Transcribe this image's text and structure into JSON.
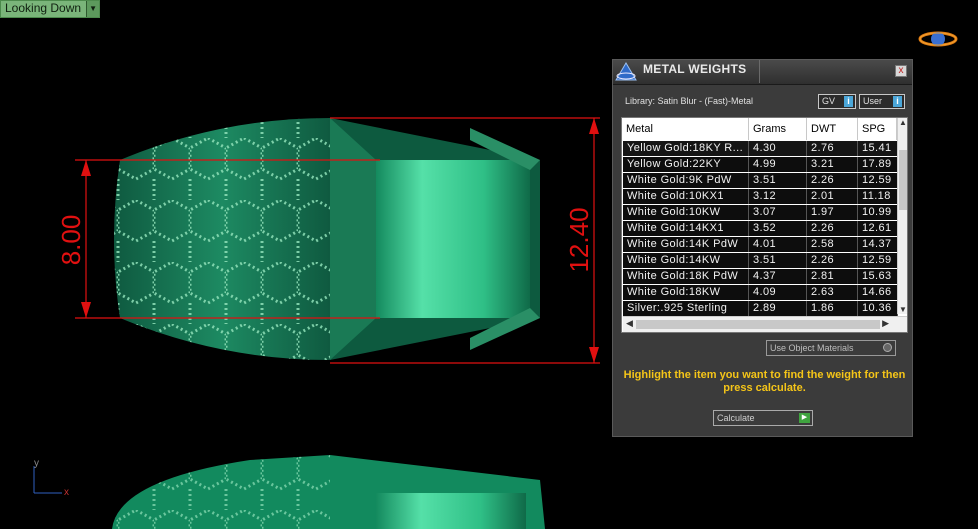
{
  "view": {
    "dropdown_label": "Looking Down",
    "dropdown_arrow": "▼"
  },
  "dimensions": {
    "left": "8.00",
    "right": "12.40"
  },
  "axes": {
    "x": "x",
    "y": "y"
  },
  "colors": {
    "model": "#1f9a70",
    "dimension": "#e01010",
    "instruction": "#f5c518"
  },
  "panel": {
    "title": "METAL WEIGHTS",
    "close_glyph": "x",
    "library": "Library: Satin Blur - (Fast)-Metal",
    "gv_label": "GV",
    "user_label": "User",
    "info_glyph": "i",
    "table": {
      "columns": [
        "Metal",
        "Grams",
        "DWT",
        "SPG"
      ],
      "rows": [
        [
          "Yellow Gold:18KY R...",
          "4.30",
          "2.76",
          "15.41"
        ],
        [
          "Yellow Gold:22KY",
          "4.99",
          "3.21",
          "17.89"
        ],
        [
          "White Gold:9K PdW",
          "3.51",
          "2.26",
          "12.59"
        ],
        [
          "White Gold:10KX1",
          "3.12",
          "2.01",
          "11.18"
        ],
        [
          "White Gold:10KW",
          "3.07",
          "1.97",
          "10.99"
        ],
        [
          "White Gold:14KX1",
          "3.52",
          "2.26",
          "12.61"
        ],
        [
          "White Gold:14K PdW",
          "4.01",
          "2.58",
          "14.37"
        ],
        [
          "White Gold:14KW",
          "3.51",
          "2.26",
          "12.59"
        ],
        [
          "White Gold:18K PdW",
          "4.37",
          "2.81",
          "15.63"
        ],
        [
          "White Gold:18KW",
          "4.09",
          "2.63",
          "14.66"
        ],
        [
          "Silver:.925 Sterling",
          "2.89",
          "1.86",
          "10.36"
        ]
      ]
    },
    "use_object_materials": "Use Object Materials",
    "instruction": "Highlight the item you want to find the weight for then press calculate.",
    "calculate_label": "Calculate"
  }
}
